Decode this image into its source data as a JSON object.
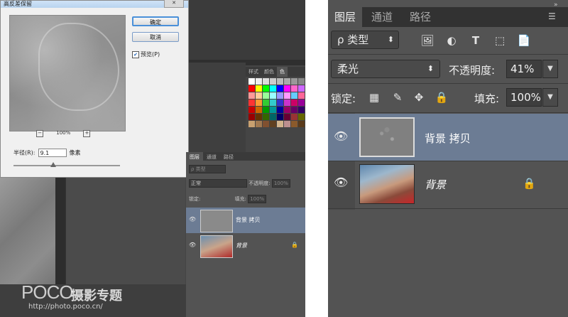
{
  "dialog": {
    "title": "高反差保留",
    "close": "✕",
    "ok_label": "确定",
    "cancel_label": "取消",
    "preview_label": "预览(P)",
    "preview_checked": "✔",
    "zoom_minus": "−",
    "zoom_plus": "+",
    "zoom_value": "100%",
    "radius_label": "半径(R):",
    "radius_value": "9.1",
    "radius_unit": "像素"
  },
  "small_panel": {
    "swatch_tabs": [
      "样式",
      "颜色",
      "色"
    ],
    "tabs": [
      "图层",
      "通道",
      "路径"
    ],
    "filter_label": "ρ 类型",
    "blend_mode": "正常",
    "opacity_label": "不透明度:",
    "opacity_value": "100%",
    "lock_label": "锁定:",
    "fill_label": "填充:",
    "fill_value": "100%",
    "layers": [
      {
        "name": "背景 拷贝",
        "eye": "👁",
        "lock": ""
      },
      {
        "name": "背景",
        "eye": "👁",
        "lock": "🔒"
      }
    ]
  },
  "watermark": {
    "brand": "POCO",
    "title": "摄影专题",
    "url": "http://photo.poco.cn/"
  },
  "layers_panel": {
    "tabs": [
      "图层",
      "通道",
      "路径"
    ],
    "menu_icon": "☰",
    "collapse_icon": "»",
    "filter": {
      "label": "ρ 类型",
      "arrow": "⬍"
    },
    "filter_icons": [
      "image-filter-icon",
      "adjustment-filter-icon",
      "type-filter-icon",
      "shape-filter-icon",
      "smart-object-filter-icon"
    ],
    "filter_glyphs": [
      "🖼",
      "◐",
      "T",
      "⬚",
      "📄"
    ],
    "blend_mode": "柔光",
    "blend_arrow": "⬍",
    "opacity_label": "不透明度:",
    "opacity_value": "41%",
    "lock_label": "锁定:",
    "lock_glyphs": [
      "▦",
      "✎",
      "✥",
      "🔒"
    ],
    "fill_label": "填充:",
    "fill_value": "100%",
    "dropdown_arrow": "▼",
    "layers": [
      {
        "name": "背景 拷贝",
        "eye": "👁",
        "lock": "",
        "selected": true
      },
      {
        "name": "背景",
        "eye": "👁",
        "lock": "🔒",
        "selected": false
      }
    ]
  },
  "colors": {
    "panel_bg": "#535353",
    "tab_bar_bg": "#323232",
    "selected_layer": "#6c7c94"
  }
}
